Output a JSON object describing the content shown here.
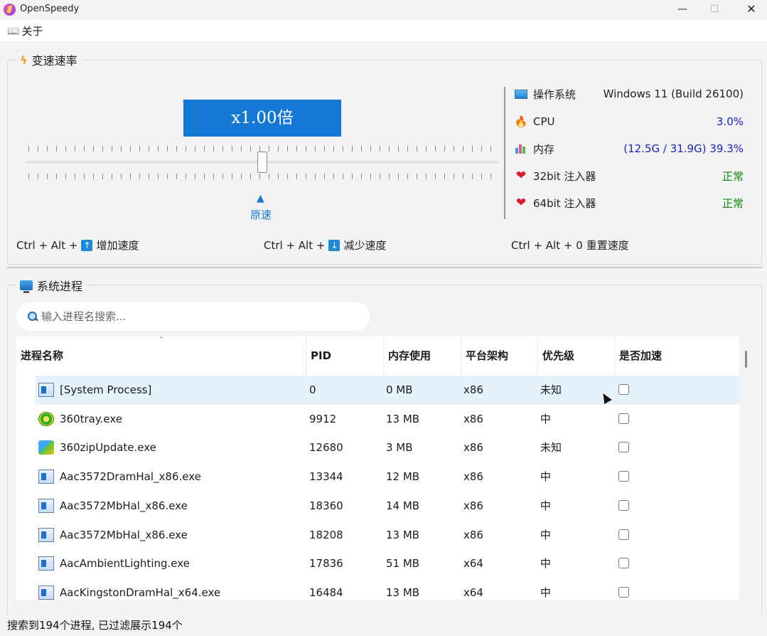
{
  "window": {
    "title": "OpenSpeedy",
    "minimize": "—",
    "maximize": "☐",
    "close": "✕"
  },
  "menu": {
    "about": "关于"
  },
  "speed_group": {
    "title": "变速速率",
    "speed_display": "x1.00倍",
    "origin_label": "原速",
    "slider_value": 1.0
  },
  "system_info": [
    {
      "label": "操作系统",
      "value": "Windows 11 (Build 26100)",
      "icon": "monitor-icon",
      "color": "dark"
    },
    {
      "label": "CPU",
      "value": "3.0%",
      "icon": "fire-icon",
      "color": "blue"
    },
    {
      "label": "内存",
      "value": "(12.5G / 31.9G) 39.3%",
      "icon": "chart-icon",
      "color": "blue"
    },
    {
      "label": "32bit 注入器",
      "value": "正常",
      "icon": "heart-icon",
      "color": "green"
    },
    {
      "label": "64bit 注入器",
      "value": "正常",
      "icon": "heart-icon",
      "color": "green"
    }
  ],
  "hotkeys": {
    "increase": {
      "combo": "Ctrl + Alt +",
      "label": "增加速度"
    },
    "decrease": {
      "combo": "Ctrl + Alt +",
      "label": "减少速度"
    },
    "reset": {
      "combo": "Ctrl + Alt + 0",
      "label": "重置速度"
    }
  },
  "process_group": {
    "title": "系统进程",
    "search_placeholder": "输入进程名搜索..."
  },
  "table": {
    "columns": [
      "进程名称",
      "PID",
      "内存使用",
      "平台架构",
      "优先级",
      "是否加速"
    ],
    "rows": [
      {
        "name": "[System Process]",
        "pid": "0",
        "mem": "0 MB",
        "arch": "x86",
        "priority": "未知",
        "icon": "window-icon",
        "accelerated": false
      },
      {
        "name": "360tray.exe",
        "pid": "9912",
        "mem": "13 MB",
        "arch": "x86",
        "priority": "中",
        "icon": "360-icon",
        "accelerated": false
      },
      {
        "name": "360zipUpdate.exe",
        "pid": "12680",
        "mem": "3 MB",
        "arch": "x86",
        "priority": "未知",
        "icon": "zip-icon",
        "accelerated": false
      },
      {
        "name": "Aac3572DramHal_x86.exe",
        "pid": "13344",
        "mem": "12 MB",
        "arch": "x86",
        "priority": "中",
        "icon": "window-icon",
        "accelerated": false
      },
      {
        "name": "Aac3572MbHal_x86.exe",
        "pid": "18360",
        "mem": "14 MB",
        "arch": "x86",
        "priority": "中",
        "icon": "window-icon",
        "accelerated": false
      },
      {
        "name": "Aac3572MbHal_x86.exe",
        "pid": "18208",
        "mem": "13 MB",
        "arch": "x86",
        "priority": "中",
        "icon": "window-icon",
        "accelerated": false
      },
      {
        "name": "AacAmbientLighting.exe",
        "pid": "17836",
        "mem": "51 MB",
        "arch": "x64",
        "priority": "中",
        "icon": "window-icon",
        "accelerated": false
      },
      {
        "name": "AacKingstonDramHal_x64.exe",
        "pid": "16484",
        "mem": "13 MB",
        "arch": "x64",
        "priority": "中",
        "icon": "window-icon",
        "accelerated": false
      }
    ]
  },
  "status": "搜索到194个进程, 已过滤展示194个"
}
